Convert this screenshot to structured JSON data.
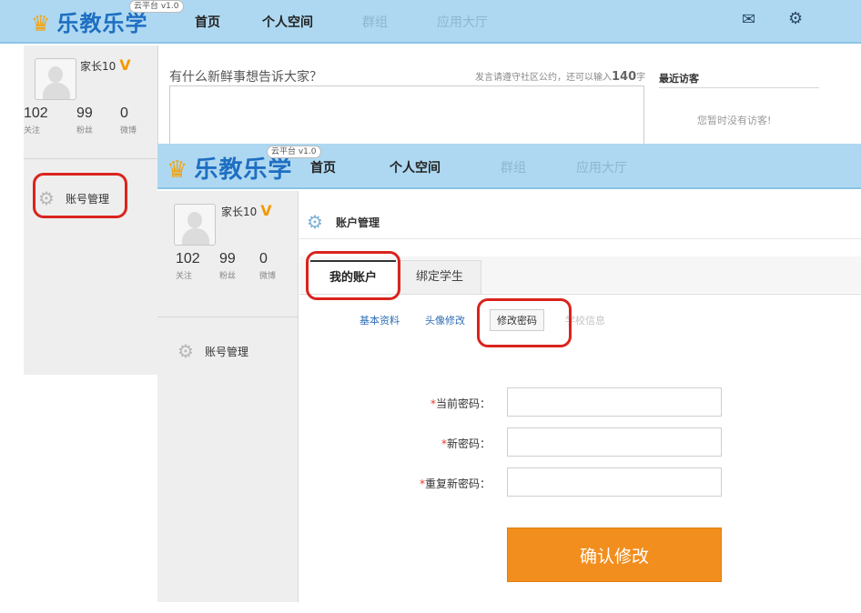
{
  "colors": {
    "nav_bg": "#aed8f1",
    "logo": "#1f6fc2",
    "accent_orange": "#f28e1e",
    "highlight_red": "#d9241d",
    "link_blue": "#2e6eb5"
  },
  "back_screen": {
    "logo": {
      "text": "乐教乐学",
      "version_badge": "云平台 v1.0",
      "icon": "mascot-icon"
    },
    "nav": [
      {
        "label": "首页",
        "state": "active"
      },
      {
        "label": "个人空间",
        "state": "active"
      },
      {
        "label": "群组",
        "state": "muted"
      },
      {
        "label": "应用大厅",
        "state": "muted"
      }
    ],
    "nav_icons": {
      "mail": "mail-icon",
      "settings": "gear-icon"
    },
    "mail_glyph": "✉",
    "gear_glyph": "⚙",
    "user": {
      "name": "家长10",
      "badge": "V"
    },
    "stats": [
      {
        "value": "102",
        "label": "关注"
      },
      {
        "value": "99",
        "label": "粉丝"
      },
      {
        "value": "0",
        "label": "微博"
      }
    ],
    "side_link": "账号管理",
    "composer": {
      "prompt": "有什么新鲜事想告诉大家？",
      "rule_prefix": "发言请遵守社区公约，还可以输入",
      "remaining": "140",
      "rule_suffix": "字"
    },
    "visitors": {
      "title": "最近访客",
      "empty": "您暂时没有访客!"
    }
  },
  "front_screen": {
    "logo": {
      "text": "乐教乐学",
      "version_badge": "云平台 v1.0"
    },
    "nav": [
      {
        "label": "首页",
        "state": "active"
      },
      {
        "label": "个人空间",
        "state": "active"
      },
      {
        "label": "群组",
        "state": "muted"
      },
      {
        "label": "应用大厅",
        "state": "muted"
      }
    ],
    "user": {
      "name": "家长10",
      "badge": "V"
    },
    "stats": [
      {
        "value": "102",
        "label": "关注"
      },
      {
        "value": "99",
        "label": "粉丝"
      },
      {
        "value": "0",
        "label": "微博"
      }
    ],
    "side_link": "账号管理",
    "page_title": "账户管理",
    "tabs": [
      {
        "label": "我的账户",
        "active": true
      },
      {
        "label": "绑定学生",
        "active": false
      }
    ],
    "subtabs": [
      {
        "label": "基本资料",
        "state": "link"
      },
      {
        "label": "头像修改",
        "state": "link"
      },
      {
        "label": "修改密码",
        "state": "active"
      },
      {
        "label": "学校信息",
        "state": "muted"
      }
    ],
    "form": {
      "required_mark": "*",
      "fields": [
        {
          "label": "当前密码：",
          "value": ""
        },
        {
          "label": "新密码：",
          "value": ""
        },
        {
          "label": "重复新密码：",
          "value": ""
        }
      ],
      "submit": "确认修改"
    }
  }
}
